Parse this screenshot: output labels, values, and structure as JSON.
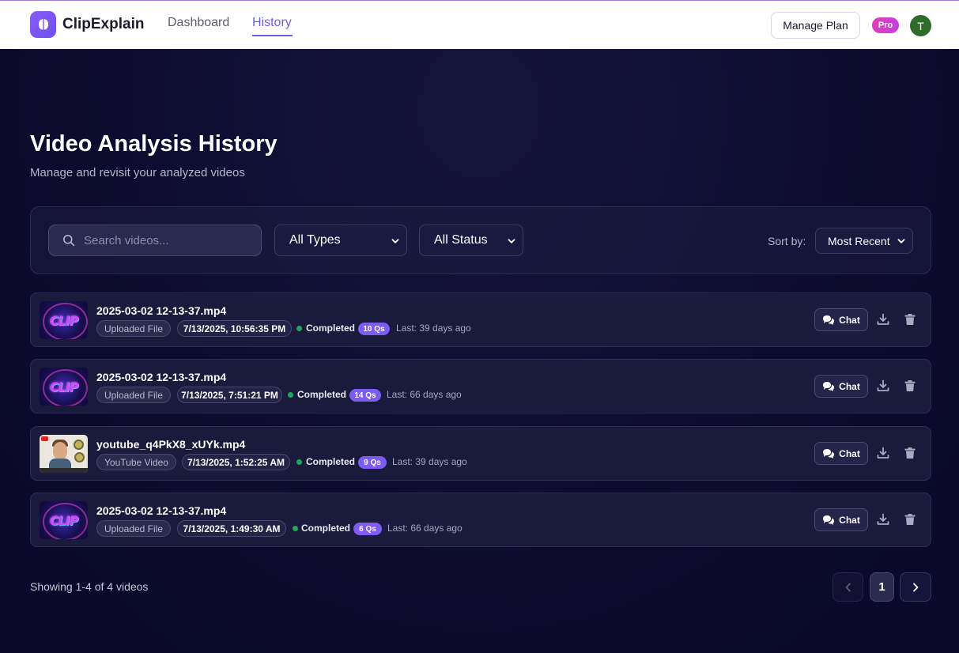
{
  "app": {
    "name": "ClipExplain",
    "brand_color": "#7c5cf2"
  },
  "nav": {
    "links": [
      "Dashboard",
      "History"
    ],
    "active": "History",
    "manage_plan_label": "Manage Plan",
    "plan_badge": "Pro",
    "avatar_initial": "T"
  },
  "page": {
    "title": "Video Analysis History",
    "subtitle": "Manage and revisit your analyzed videos"
  },
  "filters": {
    "search_placeholder": "Search videos...",
    "type_select": "All Types",
    "status_select": "All Status",
    "sort_label": "Sort by:",
    "sort_select": "Most Recent"
  },
  "videos": [
    {
      "title": "2025-03-02 12-13-37.mp4",
      "thumbnail": "clip-logo-thumbnail",
      "type": "Uploaded File",
      "date": "7/13/2025, 10:56:35 PM",
      "status": "Completed",
      "questions": "10 Qs",
      "last": "Last: 39 days ago",
      "chat_label": "Chat"
    },
    {
      "title": "2025-03-02 12-13-37.mp4",
      "thumbnail": "clip-logo-thumbnail",
      "type": "Uploaded File",
      "date": "7/13/2025, 7:51:21 PM",
      "status": "Completed",
      "questions": "14 Qs",
      "last": "Last: 66 days ago",
      "chat_label": "Chat"
    },
    {
      "title": "youtube_q4PkX8_xUYk.mp4",
      "thumbnail": "youtube-thumbnail",
      "type": "YouTube Video",
      "date": "7/13/2025, 1:52:25 AM",
      "status": "Completed",
      "questions": "9 Qs",
      "last": "Last: 39 days ago",
      "chat_label": "Chat"
    },
    {
      "title": "2025-03-02 12-13-37.mp4",
      "thumbnail": "clip-logo-thumbnail",
      "type": "Uploaded File",
      "date": "7/13/2025, 1:49:30 AM",
      "status": "Completed",
      "questions": "6 Qs",
      "last": "Last: 66 days ago",
      "chat_label": "Chat"
    }
  ],
  "thumbnail_text": "CLIP",
  "pagination": {
    "showing": "Showing 1-4 of 4 videos",
    "current_page": "1"
  },
  "colors": {
    "background": "#0b0a2c",
    "status_completed": "#22a55a",
    "qs_badge": "#7c5cf2",
    "pro_badge": "#e13fb5"
  }
}
